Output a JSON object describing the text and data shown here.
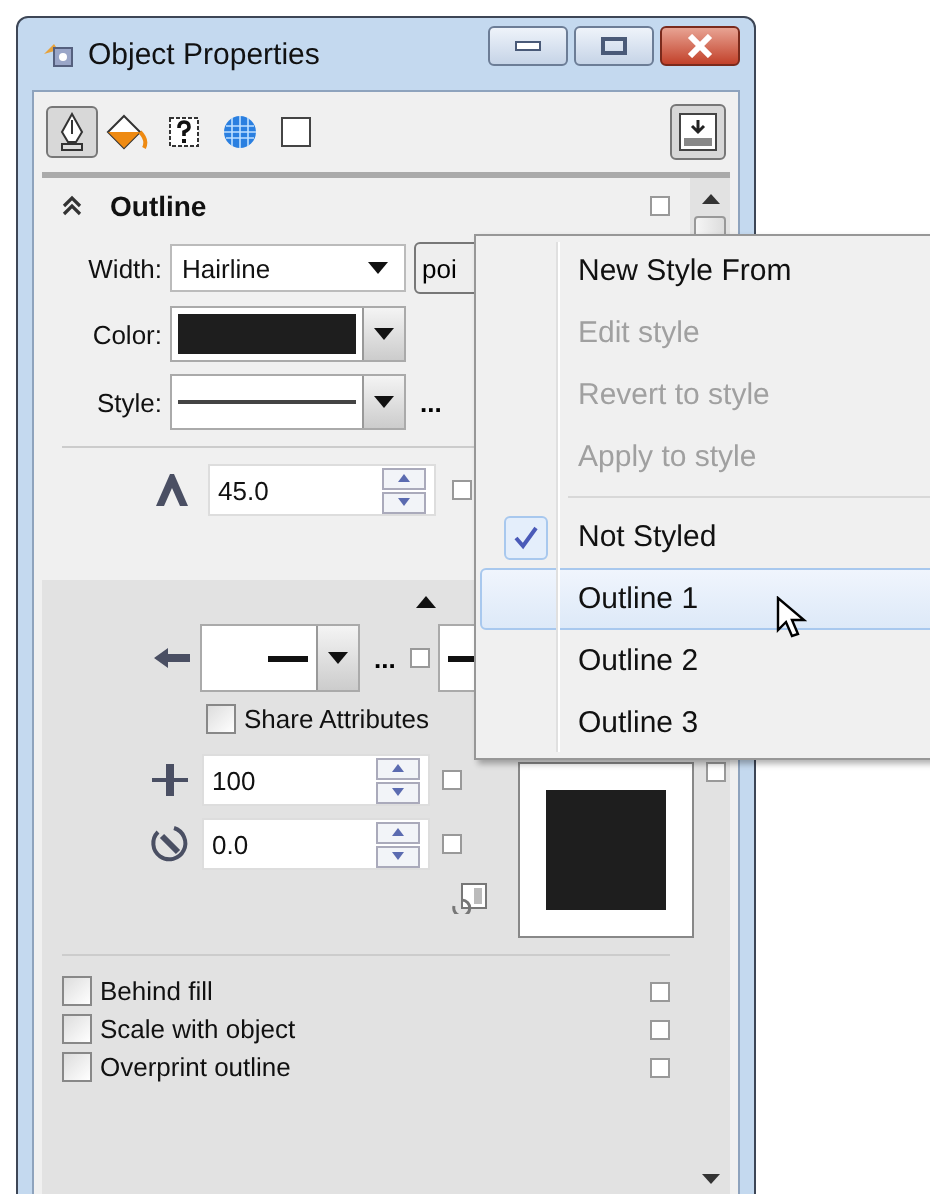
{
  "window": {
    "title": "Object Properties"
  },
  "toolbar": {
    "tabs": [
      {
        "kind": "pen",
        "selected": true
      },
      {
        "kind": "fill",
        "selected": false
      },
      {
        "kind": "summary",
        "selected": false
      },
      {
        "kind": "internet",
        "selected": false
      },
      {
        "kind": "frame",
        "selected": false
      }
    ]
  },
  "section": {
    "title": "Outline",
    "expanded": true,
    "lock": {
      "checked": false
    }
  },
  "width": {
    "label": "Width:",
    "value": "Hairline",
    "units": "poi"
  },
  "color": {
    "label": "Color:",
    "color": "#1e1e1e"
  },
  "style": {
    "label": "Style:",
    "more": "..."
  },
  "miter": {
    "value": "45.0",
    "lock": {
      "checked": false
    }
  },
  "arrows": {
    "more": "...",
    "lock": {
      "checked": false
    },
    "share": {
      "label": "Share Attributes",
      "checked": false
    }
  },
  "stretch": {
    "value": "100",
    "lock": {
      "checked": false
    }
  },
  "angle": {
    "value": "0.0",
    "lock": {
      "checked": false
    }
  },
  "preview": {
    "color": "#1e1e1e",
    "lock": {
      "checked": false
    }
  },
  "options": [
    {
      "label": "Behind fill",
      "checked": false,
      "lock": {
        "checked": false
      }
    },
    {
      "label": "Scale with object",
      "checked": false,
      "lock": {
        "checked": false
      }
    },
    {
      "label": "Overprint outline",
      "checked": false,
      "lock": {
        "checked": false
      }
    }
  ],
  "menu": {
    "items": [
      {
        "kind": "item",
        "label": "New Style From",
        "disabled": false,
        "checked": false,
        "selected": false
      },
      {
        "kind": "item",
        "label": "Edit style",
        "disabled": true,
        "checked": false,
        "selected": false
      },
      {
        "kind": "item",
        "label": "Revert to style",
        "disabled": true,
        "checked": false,
        "selected": false
      },
      {
        "kind": "item",
        "label": "Apply to style",
        "disabled": true,
        "checked": false,
        "selected": false
      },
      {
        "kind": "separator"
      },
      {
        "kind": "item",
        "label": "Not Styled",
        "disabled": false,
        "checked": true,
        "selected": false
      },
      {
        "kind": "item",
        "label": "Outline 1",
        "disabled": false,
        "checked": false,
        "selected": true
      },
      {
        "kind": "item",
        "label": "Outline 2",
        "disabled": false,
        "checked": false,
        "selected": false
      },
      {
        "kind": "item",
        "label": "Outline 3",
        "disabled": false,
        "checked": false,
        "selected": false
      }
    ]
  }
}
